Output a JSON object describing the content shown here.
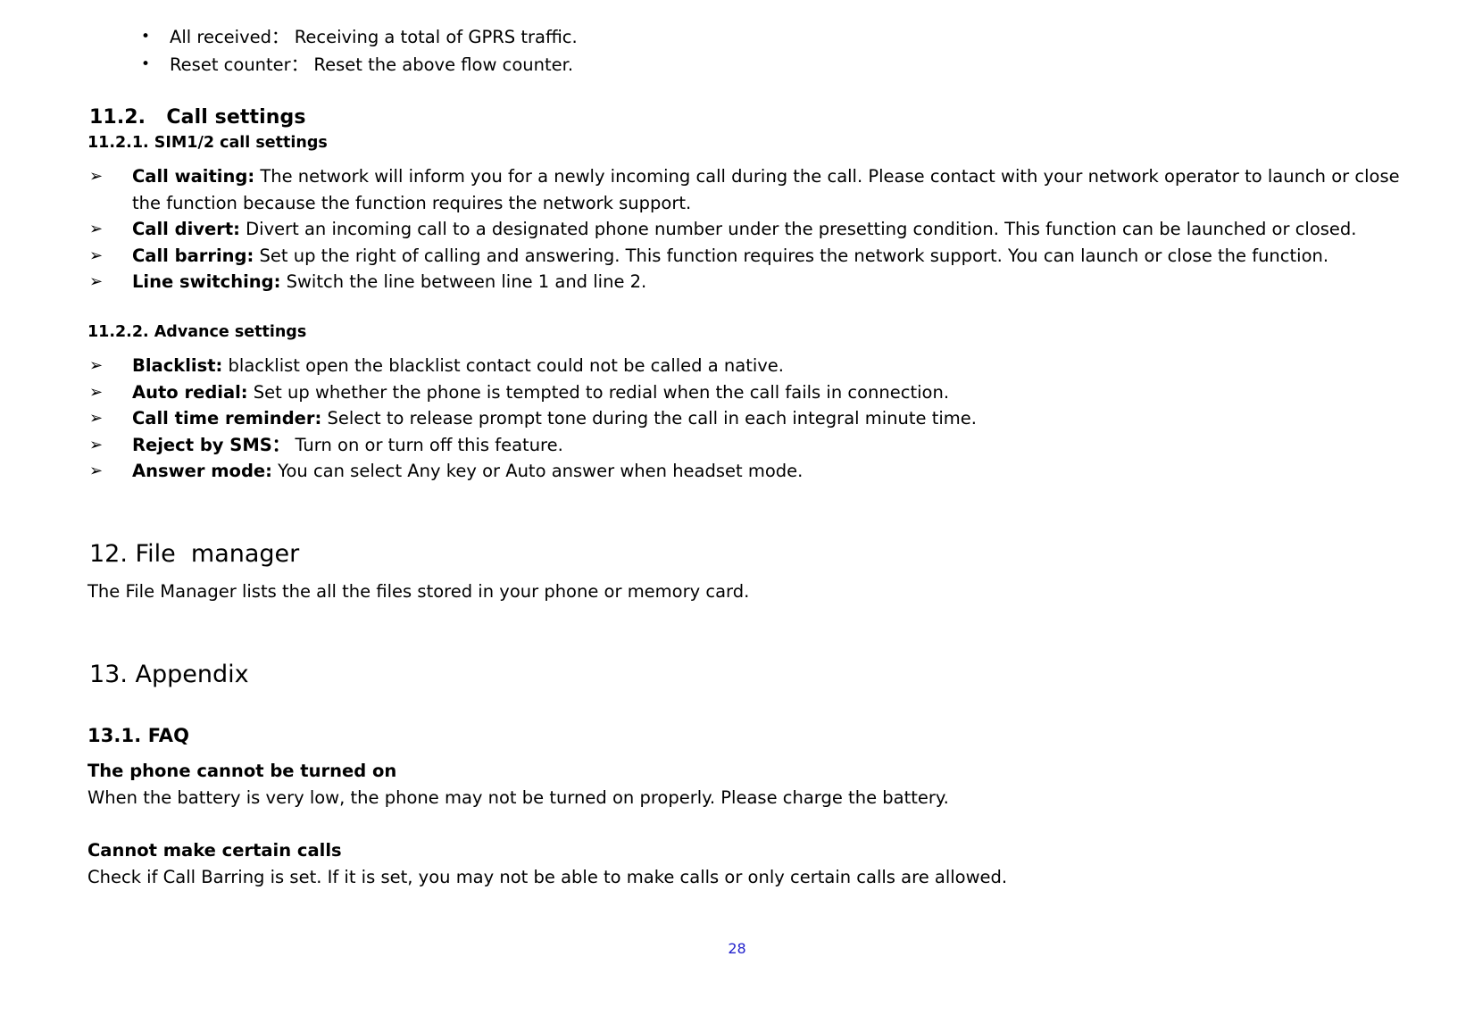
{
  "document": {
    "page_number": "28",
    "page_number_color": "#2222cc"
  },
  "top_bullets": [
    {
      "marker": "•",
      "text": "All received： Receiving a total of GPRS traffic."
    },
    {
      "marker": "•",
      "text": "Reset counter： Reset the above flow counter."
    }
  ],
  "section_11_2": {
    "number": "11.2.",
    "title": "Call settings"
  },
  "section_11_2_1": {
    "heading": "11.2.1. SIM1/2 call settings",
    "items": [
      {
        "marker": "➢",
        "term": "Call waiting:",
        "description": " The network will inform you for a newly incoming call during the call. Please contact with your network operator to launch or close the function because the function requires the network support."
      },
      {
        "marker": "➢",
        "term": "Call divert:",
        "description": " Divert an incoming call to a designated phone number under the presetting condition. This function can be launched or closed."
      },
      {
        "marker": "➢",
        "term": "Call barring:",
        "description": " Set up the right of calling and answering. This function requires the network support. You can launch or close the function."
      },
      {
        "marker": "➢",
        "term": "Line switching:",
        "description": " Switch the line between line 1 and line 2."
      }
    ]
  },
  "section_11_2_2": {
    "heading": "11.2.2. Advance settings",
    "items": [
      {
        "marker": "➢",
        "term": "Blacklist:",
        "description": " blacklist open the blacklist contact could not be called a native."
      },
      {
        "marker": "➢",
        "term": "Auto redial:",
        "description": " Set up whether the phone is tempted to redial when the call fails in connection."
      },
      {
        "marker": "➢",
        "term": "Call time reminder:",
        "description": " Select to release prompt tone during the call in each integral minute time."
      },
      {
        "marker": "➢",
        "term": "Reject by SMS：",
        "description": " Turn on or turn off this feature."
      },
      {
        "marker": "➢",
        "term": "Answer mode:",
        "description": " You can select Any key or Auto answer when headset mode."
      }
    ]
  },
  "section_12": {
    "number": "12.",
    "title": "File  manager",
    "body": "The File Manager lists the all the files stored in your phone or memory card."
  },
  "section_13": {
    "number": "13.",
    "title": "Appendix"
  },
  "section_13_1": {
    "heading": "13.1. FAQ",
    "entries": [
      {
        "question": "The phone cannot be turned on",
        "answer": "When the battery is very low, the phone may not be turned on properly. Please charge the battery."
      },
      {
        "question": "Cannot make certain calls",
        "answer": "Check if Call Barring is set. If it is set, you may not be able to make calls or only certain calls are allowed."
      }
    ]
  }
}
